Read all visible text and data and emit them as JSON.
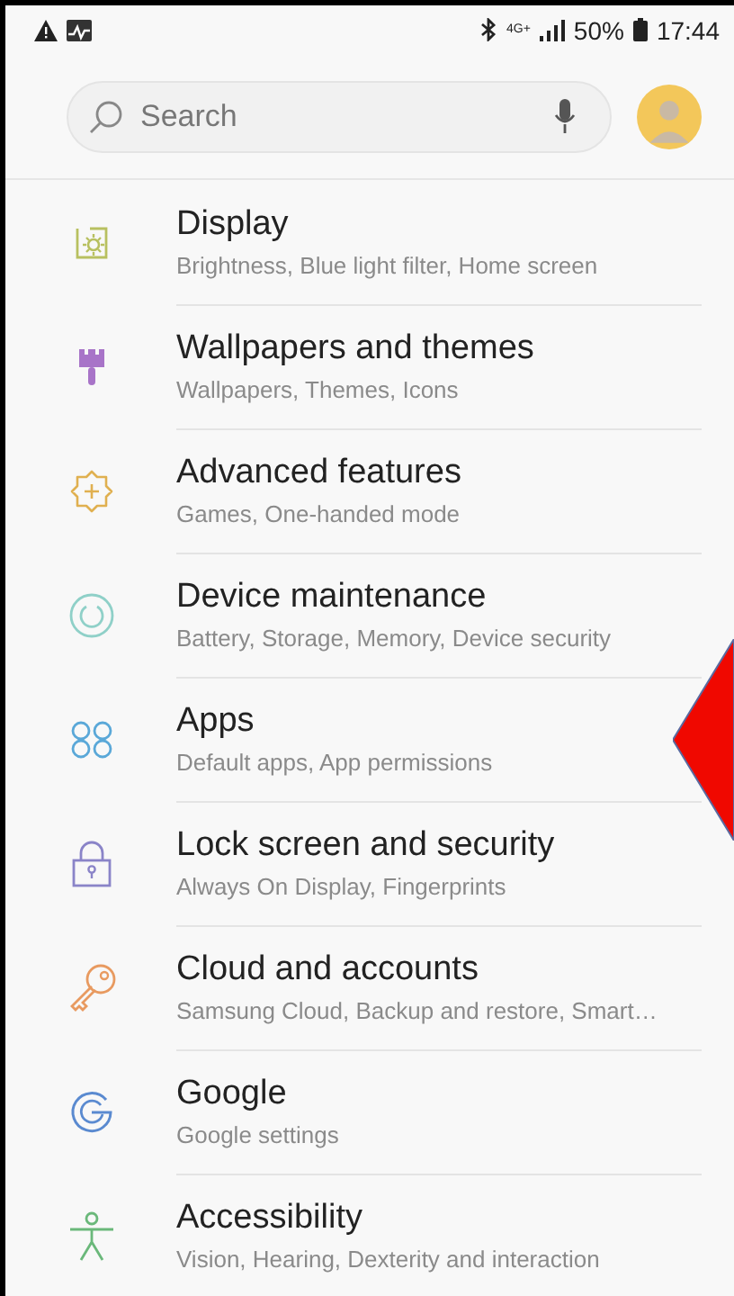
{
  "status_bar": {
    "network": "4G+",
    "battery": "50%",
    "time": "17:44"
  },
  "search": {
    "placeholder": "Search"
  },
  "items": [
    {
      "title": "Display",
      "subtitle": "Brightness, Blue light filter, Home screen"
    },
    {
      "title": "Wallpapers and themes",
      "subtitle": "Wallpapers, Themes, Icons"
    },
    {
      "title": "Advanced features",
      "subtitle": "Games, One-handed mode"
    },
    {
      "title": "Device maintenance",
      "subtitle": "Battery, Storage, Memory, Device security"
    },
    {
      "title": "Apps",
      "subtitle": "Default apps, App permissions"
    },
    {
      "title": "Lock screen and security",
      "subtitle": "Always On Display, Fingerprints"
    },
    {
      "title": "Cloud and accounts",
      "subtitle": "Samsung Cloud, Backup and restore, Smart…"
    },
    {
      "title": "Google",
      "subtitle": "Google settings"
    },
    {
      "title": "Accessibility",
      "subtitle": "Vision, Hearing, Dexterity and interaction"
    }
  ]
}
